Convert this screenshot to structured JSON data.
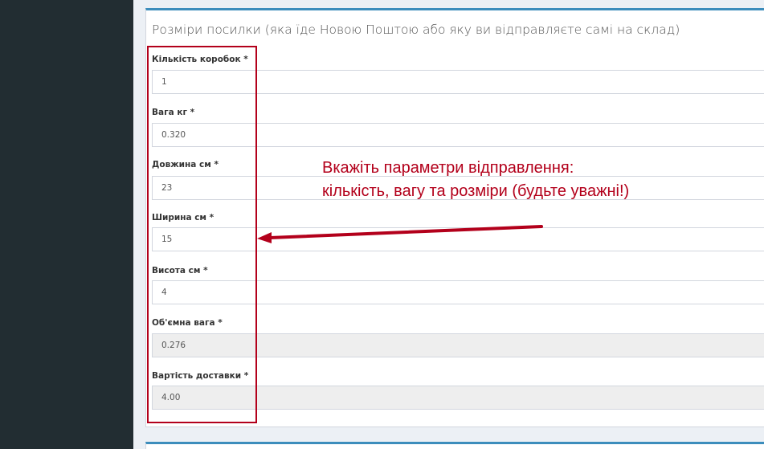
{
  "section_title": "Розміри посилки (яка їде Новою Поштою або яку ви відправляєте самі на склад)",
  "fields": [
    {
      "label": "Кількість коробок *",
      "value": "1",
      "readonly": false
    },
    {
      "label": "Вага кг *",
      "value": "0.320",
      "readonly": false
    },
    {
      "label": "Довжина см *",
      "value": "23",
      "readonly": false
    },
    {
      "label": "Ширина см *",
      "value": "15",
      "readonly": false
    },
    {
      "label": "Висота см *",
      "value": "4",
      "readonly": false
    },
    {
      "label": "Об'ємна вага *",
      "value": "0.276",
      "readonly": true
    },
    {
      "label": "Вартість доставки *",
      "value": "4.00",
      "readonly": true
    }
  ],
  "annotation": {
    "line1": "Вкажіть параметри відправлення:",
    "line2": "кількість, вагу та розміри (будьте уважні!)",
    "color": "#b3001b"
  },
  "colors": {
    "sidebar": "#222d32",
    "box_accent": "#3c8dbc",
    "background": "#ecf0f5"
  }
}
